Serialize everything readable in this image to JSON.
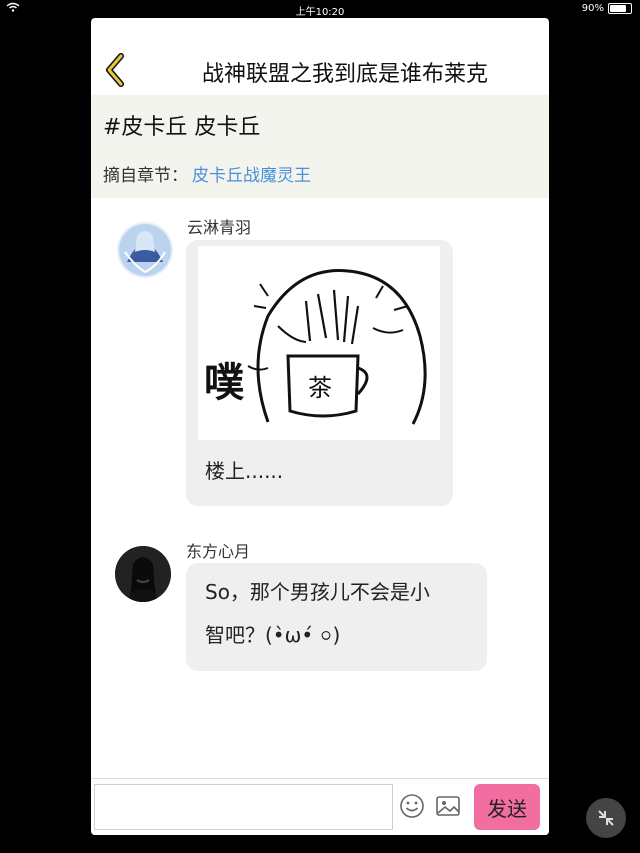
{
  "status_bar": {
    "time": "上午10:20",
    "battery": "90%",
    "battery_level": 0.9
  },
  "header": {
    "title": "战神联盟之我到底是谁布莱克",
    "back_icon": "chevron-left-icon"
  },
  "topic": {
    "title": "#皮卡丘 皮卡丘",
    "source_label": "摘自章节：",
    "source_link": "皮卡丘战魔灵王"
  },
  "messages": [
    {
      "username": "云淋青羽",
      "image_caption": "噗",
      "cup_text": "茶",
      "text": "楼上......"
    },
    {
      "username": "东方心月",
      "text_line1": "So，那个男孩儿不会是小",
      "text_line2": "智吧？(•̀ω•́ ০)"
    }
  ],
  "input_bar": {
    "placeholder": "",
    "emoji_icon": "smiley-icon",
    "image_icon": "image-icon",
    "send_label": "发送"
  },
  "colors": {
    "accent_gold": "#c9a227",
    "link_blue": "#4a90d9",
    "send_pink": "#f36ea0"
  }
}
